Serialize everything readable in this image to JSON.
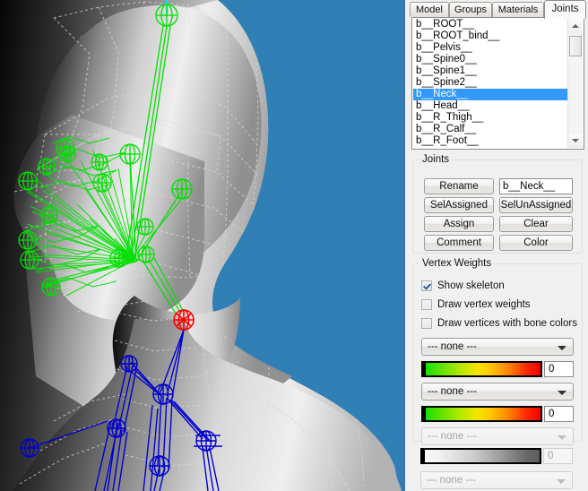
{
  "viewport": {
    "background_color": "#3180b5",
    "mesh_color": "#c8c8c8",
    "wireframe_color": "#e0e0e0",
    "skeleton_unselected_color": "#00e000",
    "skeleton_selected_color": "#ff0000",
    "skeleton_child_color": "#0000d0",
    "axis_color": "#00e5ff"
  },
  "tabs": [
    {
      "label": "Model",
      "active": false
    },
    {
      "label": "Groups",
      "active": false
    },
    {
      "label": "Materials",
      "active": false
    },
    {
      "label": "Joints",
      "active": true
    }
  ],
  "joint_list": {
    "items": [
      "b__ROOT__",
      "b__ROOT_bind__",
      "b__Pelvis__",
      "b__Spine0__",
      "b__Spine1__",
      "b__Spine2__",
      "b__Neck__",
      "b__Head__",
      "b__R_Thigh__",
      "b__R_Calf__",
      "b__R_Foot__"
    ],
    "selected_index": 6,
    "scrollbar": {
      "up_icon": "scroll-up-arrow-icon",
      "down_icon": "scroll-down-arrow-icon"
    }
  },
  "joints_group": {
    "title": "Joints",
    "rename_label": "Rename",
    "name_value": "b__Neck__",
    "sel_assigned_label": "SelAssigned",
    "sel_unassigned_label": "SelUnAssigned",
    "assign_label": "Assign",
    "clear_label": "Clear",
    "comment_label": "Comment",
    "color_label": "Color"
  },
  "vertex_weights": {
    "title": "Vertex Weights",
    "checkboxes": [
      {
        "label": "Show skeleton",
        "checked": true
      },
      {
        "label": "Draw vertex weights",
        "checked": false
      },
      {
        "label": "Draw vertices with bone colors",
        "checked": false
      }
    ],
    "weight_rows": [
      {
        "bone": "--- none ---",
        "value": "0",
        "enabled": true,
        "bar": "green-red"
      },
      {
        "bone": "--- none ---",
        "value": "0",
        "enabled": true,
        "bar": "green-red"
      },
      {
        "bone": "--- none ---",
        "value": "",
        "enabled": false,
        "bar": "none"
      }
    ],
    "outside_row": {
      "bone": "--- none ---",
      "value": "0",
      "enabled": false,
      "bar": "white-black"
    }
  }
}
